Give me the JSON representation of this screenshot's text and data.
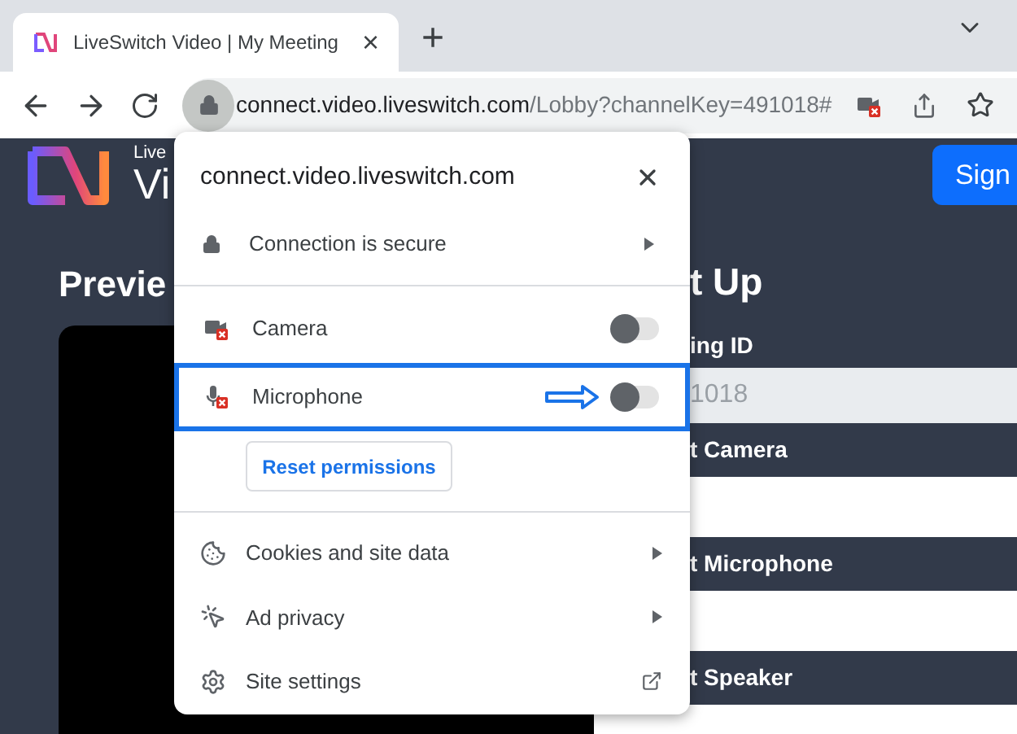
{
  "tab": {
    "title": "LiveSwitch Video | My Meeting",
    "close": "×",
    "new_tab": "+"
  },
  "address_bar": {
    "host": "connect.video.liveswitch.com",
    "path": "/Lobby?channelKey=491018#"
  },
  "page": {
    "logo_small": "Live",
    "logo_large": "Vi",
    "sign_button": "Sign",
    "preview_heading": "Previe",
    "setup_heading": "t Up",
    "meeting_id_label": "ing ID",
    "meeting_id_value": "1018",
    "sections": [
      {
        "label": "t Camera"
      },
      {
        "label": "t Microphone"
      },
      {
        "label": "t Speaker"
      }
    ]
  },
  "popup": {
    "title": "connect.video.liveswitch.com",
    "security": {
      "label": "Connection is secure"
    },
    "permissions": [
      {
        "kind": "camera",
        "label": "Camera",
        "on": false,
        "highlighted": false
      },
      {
        "kind": "microphone",
        "label": "Microphone",
        "on": false,
        "highlighted": true
      }
    ],
    "reset_button": "Reset permissions",
    "menu": [
      {
        "kind": "cookies",
        "label": "Cookies and site data",
        "submenu": true,
        "external": false
      },
      {
        "kind": "ad",
        "label": "Ad privacy",
        "submenu": true,
        "external": false
      },
      {
        "kind": "settings",
        "label": "Site settings",
        "submenu": false,
        "external": true
      }
    ]
  }
}
